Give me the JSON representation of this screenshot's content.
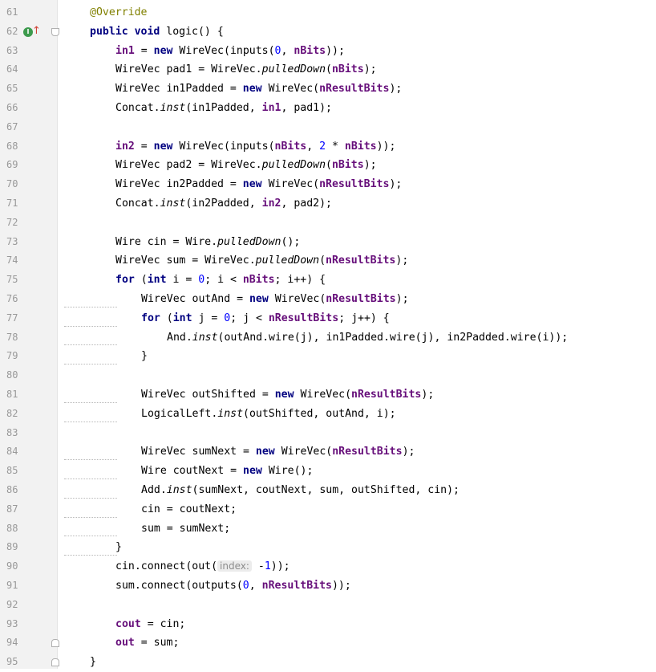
{
  "editor": {
    "lines": [
      {
        "n": "61",
        "indent": 1,
        "segs": [
          {
            "t": "@Override",
            "c": "anno"
          }
        ]
      },
      {
        "n": "62",
        "indent": 1,
        "segs": [
          {
            "t": "public",
            "c": "kw"
          },
          {
            "t": " "
          },
          {
            "t": "void",
            "c": "kw"
          },
          {
            "t": " logic() {"
          }
        ]
      },
      {
        "n": "63",
        "indent": 2,
        "segs": [
          {
            "t": "in1",
            "c": "field"
          },
          {
            "t": " = "
          },
          {
            "t": "new",
            "c": "kw"
          },
          {
            "t": " WireVec(inputs("
          },
          {
            "t": "0",
            "c": "num"
          },
          {
            "t": ", "
          },
          {
            "t": "nBits",
            "c": "field"
          },
          {
            "t": "));"
          }
        ]
      },
      {
        "n": "64",
        "indent": 2,
        "segs": [
          {
            "t": "WireVec pad1 = WireVec."
          },
          {
            "t": "pulledDown",
            "c": "italic"
          },
          {
            "t": "("
          },
          {
            "t": "nBits",
            "c": "field"
          },
          {
            "t": ");"
          }
        ]
      },
      {
        "n": "65",
        "indent": 2,
        "segs": [
          {
            "t": "WireVec in1Padded = "
          },
          {
            "t": "new",
            "c": "kw"
          },
          {
            "t": " WireVec("
          },
          {
            "t": "nResultBits",
            "c": "field"
          },
          {
            "t": ");"
          }
        ]
      },
      {
        "n": "66",
        "indent": 2,
        "segs": [
          {
            "t": "Concat."
          },
          {
            "t": "inst",
            "c": "italic"
          },
          {
            "t": "(in1Padded, "
          },
          {
            "t": "in1",
            "c": "field"
          },
          {
            "t": ", pad1);"
          }
        ]
      },
      {
        "n": "67",
        "indent": 0,
        "segs": []
      },
      {
        "n": "68",
        "indent": 2,
        "segs": [
          {
            "t": "in2",
            "c": "field"
          },
          {
            "t": " = "
          },
          {
            "t": "new",
            "c": "kw"
          },
          {
            "t": " WireVec(inputs("
          },
          {
            "t": "nBits",
            "c": "field"
          },
          {
            "t": ", "
          },
          {
            "t": "2",
            "c": "num"
          },
          {
            "t": " * "
          },
          {
            "t": "nBits",
            "c": "field"
          },
          {
            "t": "));"
          }
        ]
      },
      {
        "n": "69",
        "indent": 2,
        "segs": [
          {
            "t": "WireVec pad2 = WireVec."
          },
          {
            "t": "pulledDown",
            "c": "italic"
          },
          {
            "t": "("
          },
          {
            "t": "nBits",
            "c": "field"
          },
          {
            "t": ");"
          }
        ]
      },
      {
        "n": "70",
        "indent": 2,
        "segs": [
          {
            "t": "WireVec in2Padded = "
          },
          {
            "t": "new",
            "c": "kw"
          },
          {
            "t": " WireVec("
          },
          {
            "t": "nResultBits",
            "c": "field"
          },
          {
            "t": ");"
          }
        ]
      },
      {
        "n": "71",
        "indent": 2,
        "segs": [
          {
            "t": "Concat."
          },
          {
            "t": "inst",
            "c": "italic"
          },
          {
            "t": "(in2Padded, "
          },
          {
            "t": "in2",
            "c": "field"
          },
          {
            "t": ", pad2);"
          }
        ]
      },
      {
        "n": "72",
        "indent": 0,
        "segs": []
      },
      {
        "n": "73",
        "indent": 2,
        "segs": [
          {
            "t": "Wire cin = Wire."
          },
          {
            "t": "pulledDown",
            "c": "italic"
          },
          {
            "t": "();"
          }
        ]
      },
      {
        "n": "74",
        "indent": 2,
        "segs": [
          {
            "t": "WireVec sum = WireVec."
          },
          {
            "t": "pulledDown",
            "c": "italic"
          },
          {
            "t": "("
          },
          {
            "t": "nResultBits",
            "c": "field"
          },
          {
            "t": ");"
          }
        ]
      },
      {
        "n": "75",
        "indent": 2,
        "segs": [
          {
            "t": "for",
            "c": "kw"
          },
          {
            "t": " ("
          },
          {
            "t": "int",
            "c": "kw"
          },
          {
            "t": " i = "
          },
          {
            "t": "0",
            "c": "num"
          },
          {
            "t": "; i < "
          },
          {
            "t": "nBits",
            "c": "field"
          },
          {
            "t": "; i++) {"
          }
        ]
      },
      {
        "n": "76",
        "indent": 3,
        "squiggle": true,
        "segs": [
          {
            "t": "WireVec outAnd = "
          },
          {
            "t": "new",
            "c": "kw"
          },
          {
            "t": " WireVec("
          },
          {
            "t": "nResultBits",
            "c": "field"
          },
          {
            "t": ");"
          }
        ]
      },
      {
        "n": "77",
        "indent": 3,
        "squiggle": true,
        "segs": [
          {
            "t": "for",
            "c": "kw"
          },
          {
            "t": " ("
          },
          {
            "t": "int",
            "c": "kw"
          },
          {
            "t": " j = "
          },
          {
            "t": "0",
            "c": "num"
          },
          {
            "t": "; j < "
          },
          {
            "t": "nResultBits",
            "c": "field"
          },
          {
            "t": "; j++) {"
          }
        ]
      },
      {
        "n": "78",
        "indent": 4,
        "squiggle": true,
        "segs": [
          {
            "t": "And."
          },
          {
            "t": "inst",
            "c": "italic"
          },
          {
            "t": "(outAnd.wire(j), in1Padded.wire(j), in2Padded.wire(i));"
          }
        ]
      },
      {
        "n": "79",
        "indent": 3,
        "squiggle": true,
        "segs": [
          {
            "t": "}"
          }
        ]
      },
      {
        "n": "80",
        "indent": 0,
        "segs": []
      },
      {
        "n": "81",
        "indent": 3,
        "squiggle": true,
        "segs": [
          {
            "t": "WireVec outShifted = "
          },
          {
            "t": "new",
            "c": "kw"
          },
          {
            "t": " WireVec("
          },
          {
            "t": "nResultBits",
            "c": "field"
          },
          {
            "t": ");"
          }
        ]
      },
      {
        "n": "82",
        "indent": 3,
        "squiggle": true,
        "segs": [
          {
            "t": "LogicalLeft."
          },
          {
            "t": "inst",
            "c": "italic"
          },
          {
            "t": "(outShifted, outAnd, i);"
          }
        ]
      },
      {
        "n": "83",
        "indent": 0,
        "segs": []
      },
      {
        "n": "84",
        "indent": 3,
        "squiggle": true,
        "segs": [
          {
            "t": "WireVec sumNext = "
          },
          {
            "t": "new",
            "c": "kw"
          },
          {
            "t": " WireVec("
          },
          {
            "t": "nResultBits",
            "c": "field"
          },
          {
            "t": ");"
          }
        ]
      },
      {
        "n": "85",
        "indent": 3,
        "squiggle": true,
        "segs": [
          {
            "t": "Wire coutNext = "
          },
          {
            "t": "new",
            "c": "kw"
          },
          {
            "t": " Wire();"
          }
        ]
      },
      {
        "n": "86",
        "indent": 3,
        "squiggle": true,
        "segs": [
          {
            "t": "Add."
          },
          {
            "t": "inst",
            "c": "italic"
          },
          {
            "t": "(sumNext, coutNext, sum, outShifted, cin);"
          }
        ]
      },
      {
        "n": "87",
        "indent": 3,
        "squiggle": true,
        "segs": [
          {
            "t": "cin = coutNext;"
          }
        ]
      },
      {
        "n": "88",
        "indent": 3,
        "squiggle": true,
        "segs": [
          {
            "t": "sum = sumNext;"
          }
        ]
      },
      {
        "n": "89",
        "indent": 2,
        "squiggle": true,
        "segs": [
          {
            "t": "}"
          }
        ]
      },
      {
        "n": "90",
        "indent": 2,
        "segs": [
          {
            "t": "cin.connect(out("
          },
          {
            "t": "index:",
            "c": "hint"
          },
          {
            "t": " -"
          },
          {
            "t": "1",
            "c": "num"
          },
          {
            "t": "));"
          }
        ]
      },
      {
        "n": "91",
        "indent": 2,
        "segs": [
          {
            "t": "sum.connect(outputs("
          },
          {
            "t": "0",
            "c": "num"
          },
          {
            "t": ", "
          },
          {
            "t": "nResultBits",
            "c": "field"
          },
          {
            "t": "));"
          }
        ]
      },
      {
        "n": "92",
        "indent": 0,
        "segs": []
      },
      {
        "n": "93",
        "indent": 2,
        "segs": [
          {
            "t": "cout",
            "c": "field"
          },
          {
            "t": " = cin;"
          }
        ]
      },
      {
        "n": "94",
        "indent": 2,
        "segs": [
          {
            "t": "out",
            "c": "field"
          },
          {
            "t": " = sum;"
          }
        ]
      },
      {
        "n": "95",
        "indent": 1,
        "segs": [
          {
            "t": "}"
          }
        ]
      }
    ]
  },
  "gutter": {
    "override_icon": "override-method-icon",
    "override_letter": "I",
    "override_arrow": "up-arrow-icon",
    "override_arrow_glyph": "↑"
  },
  "colors": {
    "keyword": "#000080",
    "field": "#660e7a",
    "number": "#0000ff",
    "annotation": "#808000"
  }
}
